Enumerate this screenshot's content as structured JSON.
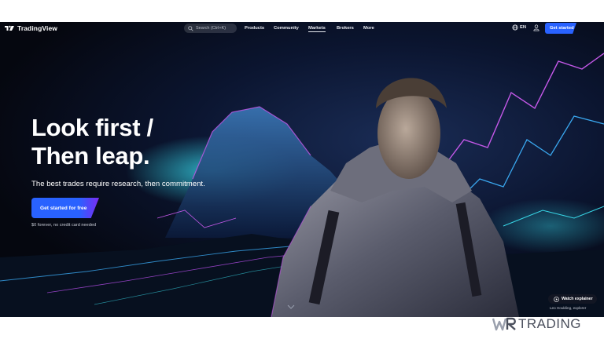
{
  "brand": {
    "name": "TradingView"
  },
  "nav": {
    "search_placeholder": "Search (Ctrl+K)",
    "links": [
      "Products",
      "Community",
      "Markets",
      "Brokers",
      "More"
    ],
    "language": "EN",
    "cta": "Get started"
  },
  "hero": {
    "headline_line1": "Look first /",
    "headline_line2": "Then leap.",
    "subheadline": "The best trades require research, then commitment.",
    "cta": "Get started for free",
    "cta_note": "$0 forever, no credit card needed",
    "watch_label": "Watch explainer",
    "credit": "Leo Houlding, explorer"
  },
  "watermark": {
    "text": "TRADING",
    "mark": "WR"
  },
  "icons": [
    "tradingview-logo-icon",
    "search-icon",
    "globe-icon",
    "user-icon",
    "play-icon",
    "chevron-down-icon"
  ],
  "colors": {
    "accent": "#2962ff",
    "accent_purple": "#7b2cf3",
    "background": "#05070f"
  }
}
